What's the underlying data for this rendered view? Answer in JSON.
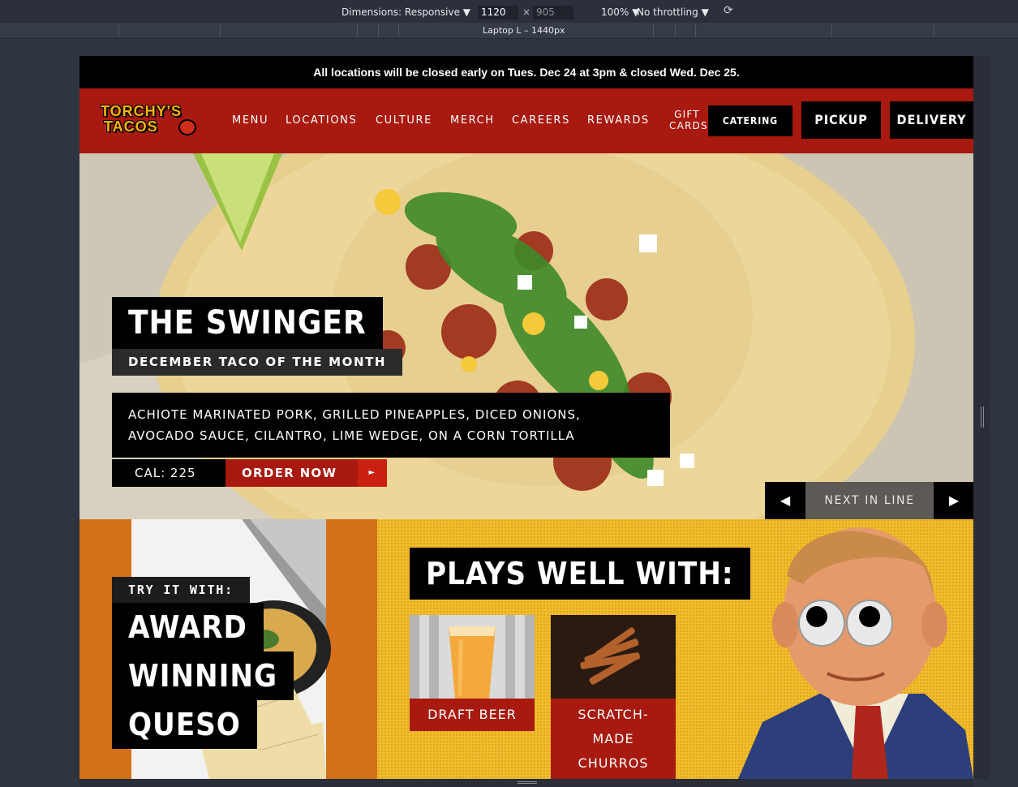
{
  "devtools": {
    "dimensions_label": "Dimensions: Responsive ▼",
    "width": "1120",
    "times": "×",
    "height": "905",
    "zoom": "100% ▼",
    "throttling": "No throttling ▼",
    "rotate_icon": "rotate-icon",
    "device_label": "Laptop L – 1440px"
  },
  "announcement": "All locations will be closed early on Tues. Dec 24 at 3pm & closed Wed. Dec 25.",
  "nav": {
    "logo_line1": "TORCHY'S",
    "logo_line2": "TACOS",
    "links": [
      "MENU",
      "LOCATIONS",
      "CULTURE",
      "MERCH",
      "CAREERS",
      "REWARDS"
    ],
    "gift_cards": "GIFT CARDS",
    "catering": "CATERING",
    "pickup": "PICKUP",
    "delivery": "DELIVERY"
  },
  "hero": {
    "title": "THE SWINGER",
    "subtitle": "DECEMBER TACO OF THE MONTH",
    "description_line1": "ACHIOTE MARINATED PORK, GRILLED PINEAPPLES, DICED ONIONS,",
    "description_line2": "AVOCADO SAUCE, CILANTRO, LIME WEDGE, ON A CORN TORTILLA",
    "calories": "CAL: 225",
    "order_button": "ORDER NOW",
    "order_arrow": "►",
    "prev_arrow": "◀",
    "next_label": "NEXT IN LINE",
    "next_arrow": "▶"
  },
  "try_it": {
    "label": "TRY IT WITH:",
    "line1": "AWARD",
    "line2": "WINNING",
    "line3": "QUESO"
  },
  "plays_well": {
    "title": "PLAYS WELL WITH:",
    "items": [
      {
        "caption": "DRAFT BEER"
      },
      {
        "caption_line1": "SCRATCH-",
        "caption_line2": "MADE",
        "caption_line3": "CHURROS"
      }
    ]
  },
  "colors": {
    "brand_red": "#a8190f",
    "orange": "#d4711a",
    "mustard": "#efbc2e",
    "black": "#000000"
  }
}
